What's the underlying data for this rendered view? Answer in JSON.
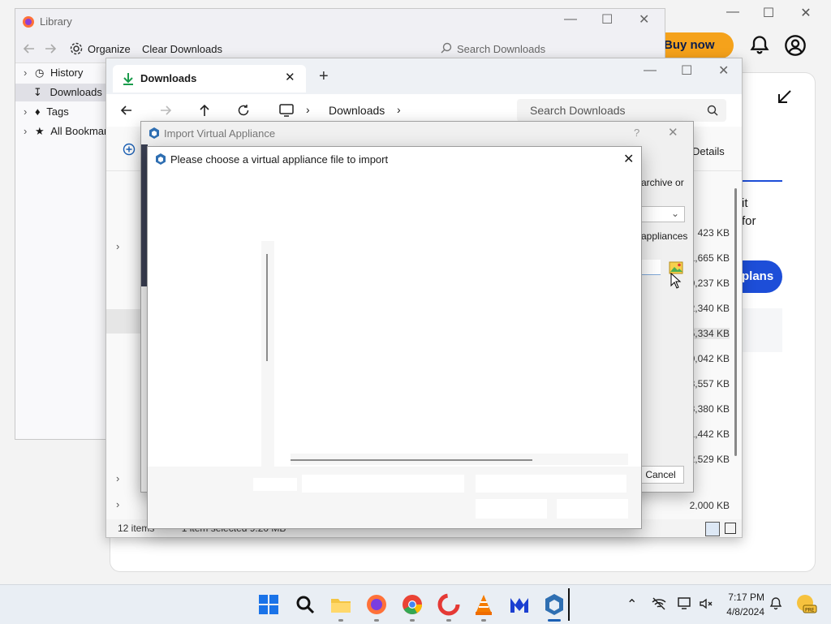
{
  "browser": {
    "buy_now": "Buy now",
    "plans_label": "plans",
    "side_text_1": "it",
    "side_text_2": "for"
  },
  "library": {
    "title": "Library",
    "organize": "Organize",
    "clear_downloads": "Clear Downloads",
    "search_placeholder": "Search Downloads",
    "tree": [
      {
        "label": "History"
      },
      {
        "label": "Downloads"
      },
      {
        "label": "Tags"
      },
      {
        "label": "All Bookmarks"
      }
    ]
  },
  "downloads": {
    "tab_title": "Downloads",
    "breadcrumb": "Downloads",
    "search_placeholder": "Search Downloads",
    "details": "Details",
    "sizes": [
      "423 KB",
      "1,665 KB",
      "0,237 KB",
      "2,340 KB",
      "5,334 KB",
      "0,042 KB",
      "8,557 KB",
      "3,380 KB",
      "1,442 KB",
      "2,529 KB",
      "2,000 KB"
    ],
    "status_items": "12 items",
    "status_selected": "1 item selected  9.20 MB"
  },
  "import_dialog": {
    "title": "Import Virtual Appliance",
    "help": "?",
    "text_archive": "archive or",
    "text_appliances": "appliances",
    "cancel": "Cancel"
  },
  "file_dialog": {
    "title": "Please choose a virtual appliance file to import"
  },
  "taskbar": {
    "time": "7:17 PM",
    "date": "4/8/2024",
    "apps": [
      "start",
      "search",
      "file-explorer",
      "firefox",
      "chrome",
      "ccleaner",
      "vlc",
      "malwarebytes",
      "virtualbox"
    ]
  },
  "colors": {
    "accent": "#1d4ed8",
    "buy_now": "#f5a21b",
    "downloads_green": "#1a9b4b"
  }
}
